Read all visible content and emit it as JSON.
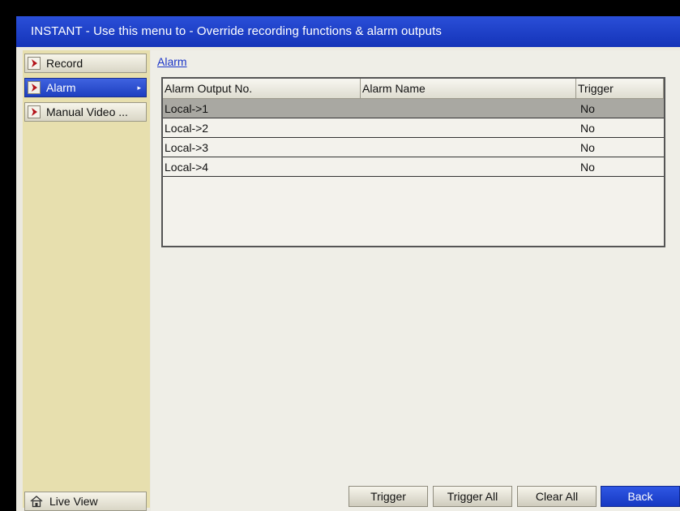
{
  "window": {
    "title": "INSTANT - Use this menu to - Override recording functions & alarm outputs"
  },
  "sidebar": {
    "items": [
      {
        "label": "Record",
        "active": false
      },
      {
        "label": "Alarm",
        "active": true
      },
      {
        "label": "Manual Video ...",
        "active": false
      }
    ],
    "live_view_label": "Live View"
  },
  "main": {
    "tab_label": "Alarm",
    "table": {
      "columns": [
        "Alarm Output No.",
        "Alarm Name",
        "Trigger"
      ],
      "rows": [
        {
          "output": "Local->1",
          "name": "",
          "trigger": "No",
          "selected": true
        },
        {
          "output": "Local->2",
          "name": "",
          "trigger": "No",
          "selected": false
        },
        {
          "output": "Local->3",
          "name": "",
          "trigger": "No",
          "selected": false
        },
        {
          "output": "Local->4",
          "name": "",
          "trigger": "No",
          "selected": false
        }
      ]
    },
    "buttons": {
      "trigger": "Trigger",
      "trigger_all": "Trigger All",
      "clear_all": "Clear All",
      "back": "Back"
    }
  },
  "colors": {
    "accent": "#1f3fc4",
    "sidebar_bg": "#e7dfae",
    "selected_row": "#a9a8a2"
  }
}
